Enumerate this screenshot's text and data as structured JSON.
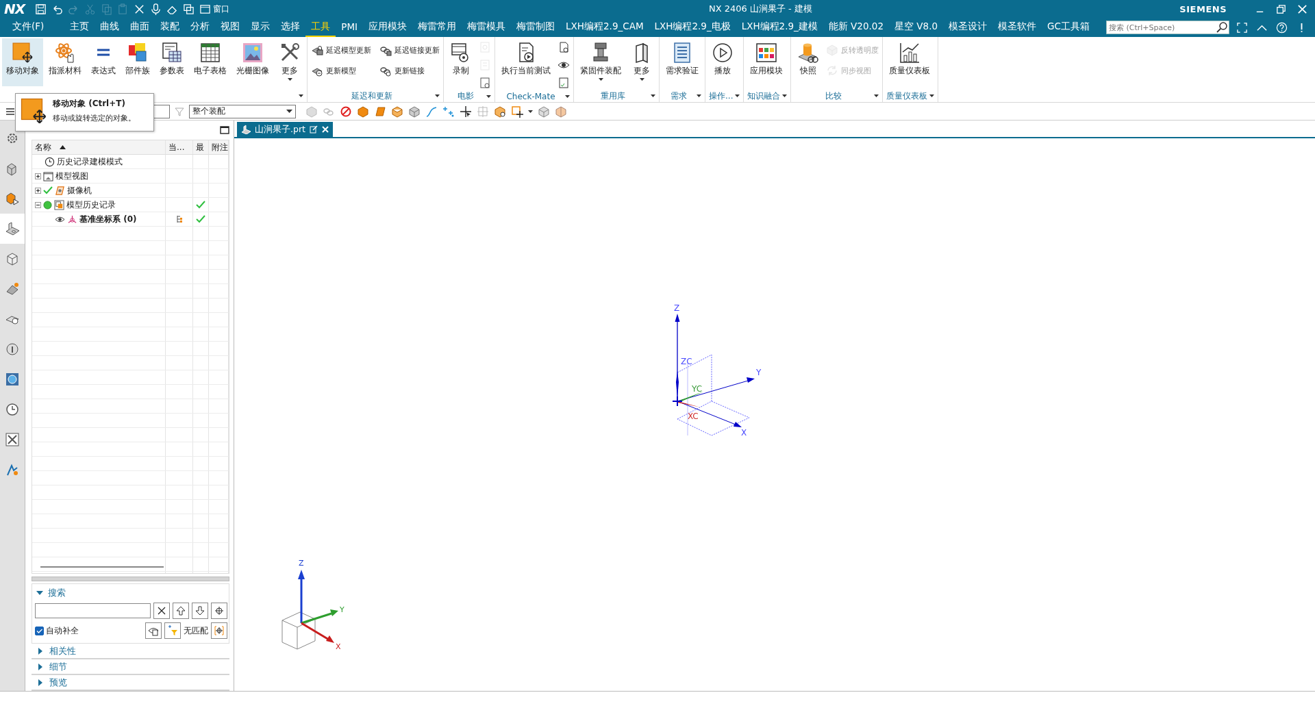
{
  "window": {
    "logo": "NX",
    "title": "NX 2406 山涧果子 - 建模",
    "brand": "SIEMENS",
    "window_menu": "窗口"
  },
  "menu_tabs": [
    {
      "label": "文件(F)",
      "selected": false
    },
    {
      "label": "主页",
      "selected": false
    },
    {
      "label": "曲线",
      "selected": false
    },
    {
      "label": "曲面",
      "selected": false
    },
    {
      "label": "装配",
      "selected": false
    },
    {
      "label": "分析",
      "selected": false
    },
    {
      "label": "视图",
      "selected": false
    },
    {
      "label": "显示",
      "selected": false
    },
    {
      "label": "选择",
      "selected": false
    },
    {
      "label": "工具",
      "selected": true
    },
    {
      "label": "PMI",
      "selected": false
    },
    {
      "label": "应用模块",
      "selected": false
    },
    {
      "label": "梅雷常用",
      "selected": false
    },
    {
      "label": "梅雷模具",
      "selected": false
    },
    {
      "label": "梅雷制图",
      "selected": false
    },
    {
      "label": "LXH编程2.9_CAM",
      "selected": false
    },
    {
      "label": "LXH编程2.9_电极",
      "selected": false
    },
    {
      "label": "LXH编程2.9_建模",
      "selected": false
    },
    {
      "label": "能新 V20.02",
      "selected": false
    },
    {
      "label": "星空 V8.0",
      "selected": false
    },
    {
      "label": "模圣设计",
      "selected": false
    },
    {
      "label": "模圣软件",
      "selected": false
    },
    {
      "label": "GC工具箱",
      "selected": false
    }
  ],
  "search": {
    "placeholder": "搜索 (Ctrl+Space)"
  },
  "ribbon_groups": [
    {
      "buttons": [
        {
          "label": "移动对象",
          "kind": "large",
          "highlighted": true,
          "disabled": false,
          "dropdown": false
        },
        {
          "label": "指派材料",
          "kind": "large",
          "highlighted": false,
          "disabled": false,
          "dropdown": false
        },
        {
          "label": "表达式",
          "kind": "large",
          "highlighted": false,
          "disabled": false,
          "dropdown": false
        },
        {
          "label": "部件族",
          "kind": "large",
          "highlighted": false,
          "disabled": false,
          "dropdown": false
        },
        {
          "label": "参数表",
          "kind": "large",
          "highlighted": false,
          "disabled": false,
          "dropdown": false
        },
        {
          "label": "电子表格",
          "kind": "large",
          "highlighted": false,
          "disabled": false,
          "dropdown": false
        },
        {
          "label": "光栅图像",
          "kind": "large",
          "highlighted": false,
          "disabled": false,
          "dropdown": false
        },
        {
          "label": "更多",
          "kind": "large",
          "highlighted": false,
          "disabled": false,
          "dropdown": true
        }
      ]
    },
    {
      "label": "延迟和更新",
      "buttons": [
        {
          "label": "延迟模型更新",
          "kind": "small",
          "disabled": false
        },
        {
          "label": "更新模型",
          "kind": "small",
          "disabled": false
        },
        {
          "label": "延迟链接更新",
          "kind": "small",
          "disabled": false
        },
        {
          "label": "更新链接",
          "kind": "small",
          "disabled": false
        }
      ]
    },
    {
      "label": "电影",
      "buttons": [
        {
          "label": "录制",
          "kind": "large",
          "highlighted": false,
          "disabled": false,
          "dropdown": false
        },
        {
          "kind": "icon",
          "disabled": true
        },
        {
          "kind": "icon",
          "disabled": true
        },
        {
          "kind": "icon",
          "disabled": false
        }
      ]
    },
    {
      "label": "Check-Mate",
      "buttons": [
        {
          "label": "执行当前测试",
          "kind": "large",
          "highlighted": false,
          "disabled": false,
          "dropdown": false
        },
        {
          "kind": "icon",
          "disabled": false
        },
        {
          "kind": "icon",
          "disabled": false
        },
        {
          "kind": "icon",
          "disabled": false
        }
      ]
    },
    {
      "label": "重用库",
      "buttons": [
        {
          "label": "紧固件装配",
          "kind": "large",
          "highlighted": false,
          "disabled": false,
          "dropdown": true
        },
        {
          "label": "更多",
          "kind": "large",
          "highlighted": false,
          "disabled": false,
          "dropdown": true
        }
      ]
    },
    {
      "label": "需求",
      "buttons": [
        {
          "label": "需求验证",
          "kind": "large",
          "highlighted": false,
          "disabled": false,
          "dropdown": false
        }
      ]
    },
    {
      "label": "操作...",
      "buttons": [
        {
          "label": "播放",
          "kind": "large",
          "highlighted": false,
          "disabled": false,
          "dropdown": false
        }
      ]
    },
    {
      "label": "知识融合",
      "buttons": [
        {
          "label": "应用模块",
          "kind": "large",
          "highlighted": false,
          "disabled": false,
          "dropdown": false
        }
      ]
    },
    {
      "label": "比较",
      "buttons": [
        {
          "label": "快照",
          "kind": "large",
          "highlighted": false,
          "disabled": false,
          "dropdown": false
        },
        {
          "label": "反转透明度",
          "kind": "small",
          "disabled": true
        },
        {
          "label": "同步视图",
          "kind": "small",
          "disabled": true
        }
      ]
    },
    {
      "label": "质量仪表板",
      "buttons": [
        {
          "label": "质量仪表板",
          "kind": "large",
          "highlighted": false,
          "disabled": false,
          "dropdown": false
        }
      ]
    }
  ],
  "toolbar": {
    "assembly_scope": "整个装配"
  },
  "tooltip": {
    "title": "移动对象 (Ctrl+T)",
    "description": "移动或旋转选定的对象。"
  },
  "resource_tabs": [
    {
      "selected": false
    },
    {
      "selected": false
    },
    {
      "selected": false
    },
    {
      "selected": true
    },
    {
      "selected": false
    },
    {
      "selected": false
    },
    {
      "selected": false
    },
    {
      "selected": false
    },
    {
      "selected": false
    },
    {
      "selected": false
    },
    {
      "selected": false
    },
    {
      "selected": false
    }
  ],
  "navigator": {
    "columns": [
      {
        "label": "名称",
        "sorted": true
      },
      {
        "label": "当...",
        "sorted": false
      },
      {
        "label": "最",
        "sorted": false
      },
      {
        "label": "附注",
        "sorted": false
      }
    ],
    "rows": [
      {
        "label": "历史记录建模模式",
        "kind": "mode",
        "visible": false,
        "latest": false,
        "current": false
      },
      {
        "label": "模型视图",
        "kind": "views",
        "expanded": false,
        "visible": false,
        "latest": false,
        "current": false
      },
      {
        "label": "摄像机",
        "kind": "camera",
        "expanded": false,
        "visible": true,
        "latest": false,
        "current": false
      },
      {
        "label": "模型历史记录",
        "kind": "history",
        "expanded": true,
        "visible": false,
        "latest": true,
        "current": false,
        "children": [
          {
            "label": "基准坐标系 (0)",
            "kind": "datum",
            "visible": false,
            "latest": true,
            "current": true
          }
        ]
      }
    ]
  },
  "search_panel": {
    "title": "搜索",
    "expanded": true,
    "autocomplete": {
      "label": "自动补全",
      "checked": true
    },
    "status": "无匹配"
  },
  "sections": [
    {
      "title": "相关性",
      "expanded": false
    },
    {
      "title": "细节",
      "expanded": false
    },
    {
      "title": "预览",
      "expanded": false
    }
  ],
  "document_tab": {
    "label": "山涧果子.prt"
  },
  "datum_triad": {
    "z": "Z",
    "zc": "ZC",
    "y": "Y",
    "yc": "YC",
    "xc": "XC",
    "x": "X"
  },
  "view_triad": {
    "z": "Z",
    "y": "Y",
    "x": "X"
  }
}
